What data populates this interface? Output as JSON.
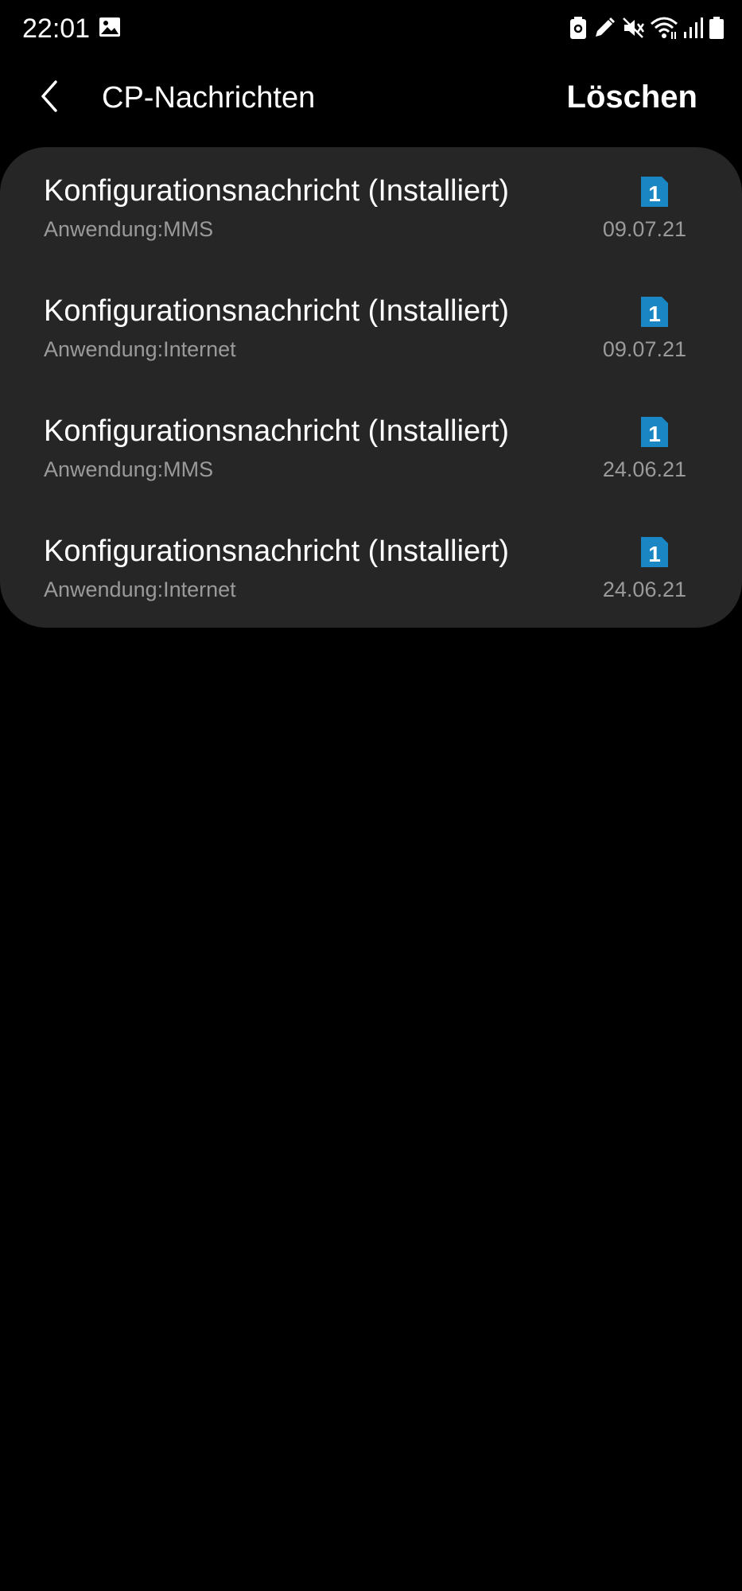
{
  "status_bar": {
    "time": "22:01",
    "left_icons": [
      "gallery-icon"
    ],
    "right_icons": [
      "battery-saver-icon",
      "pen-icon",
      "mute-icon",
      "wifi-icon",
      "signal-icon",
      "battery-icon"
    ]
  },
  "app_bar": {
    "back_icon": "chevron-left-icon",
    "title": "CP-Nachrichten",
    "action_label": "Löschen"
  },
  "messages": [
    {
      "title": "Konfigurationsnachricht (Installiert)",
      "subtitle": "Anwendung:MMS",
      "date": "09.07.21",
      "sim": "1"
    },
    {
      "title": "Konfigurationsnachricht (Installiert)",
      "subtitle": "Anwendung:Internet",
      "date": "09.07.21",
      "sim": "1"
    },
    {
      "title": "Konfigurationsnachricht (Installiert)",
      "subtitle": "Anwendung:MMS",
      "date": "24.06.21",
      "sim": "1"
    },
    {
      "title": "Konfigurationsnachricht (Installiert)",
      "subtitle": "Anwendung:Internet",
      "date": "24.06.21",
      "sim": "1"
    }
  ],
  "colors": {
    "background": "#000000",
    "card": "#262626",
    "primary_text": "#ffffff",
    "secondary_text": "#9a9a9a",
    "sim_badge": "#1b86c4"
  }
}
